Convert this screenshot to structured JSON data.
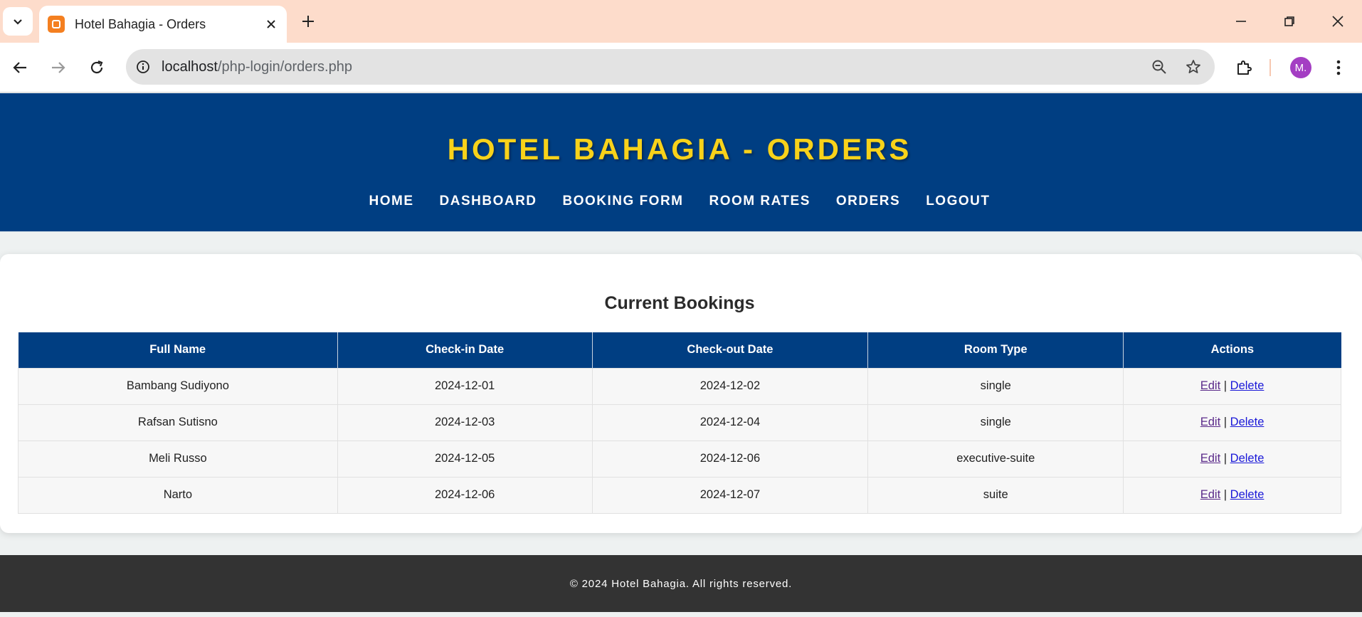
{
  "browser": {
    "tab_title": "Hotel Bahagia - Orders",
    "url_host": "localhost",
    "url_path": "/php-login/orders.php",
    "avatar_initial": "M."
  },
  "site": {
    "title": "HOTEL BAHAGIA - ORDERS",
    "nav": [
      "HOME",
      "DASHBOARD",
      "BOOKING FORM",
      "ROOM RATES",
      "ORDERS",
      "LOGOUT"
    ]
  },
  "bookings": {
    "heading": "Current Bookings",
    "columns": [
      "Full Name",
      "Check-in Date",
      "Check-out Date",
      "Room Type",
      "Actions"
    ],
    "rows": [
      {
        "full_name": "Bambang Sudiyono",
        "check_in": "2024-12-01",
        "check_out": "2024-12-02",
        "room_type": "single"
      },
      {
        "full_name": "Rafsan Sutisno",
        "check_in": "2024-12-03",
        "check_out": "2024-12-04",
        "room_type": "single"
      },
      {
        "full_name": "Meli Russo",
        "check_in": "2024-12-05",
        "check_out": "2024-12-06",
        "room_type": "executive-suite"
      },
      {
        "full_name": "Narto",
        "check_in": "2024-12-06",
        "check_out": "2024-12-07",
        "room_type": "suite"
      }
    ],
    "action_edit": "Edit",
    "action_separator": "|",
    "action_delete": "Delete"
  },
  "footer": {
    "text": "© 2024 Hotel Bahagia. All rights reserved."
  },
  "colors": {
    "header_bg": "#003e82",
    "title_yellow": "#f8d21a",
    "footer_bg": "#333333",
    "tabbar_bg": "#fddccb"
  }
}
